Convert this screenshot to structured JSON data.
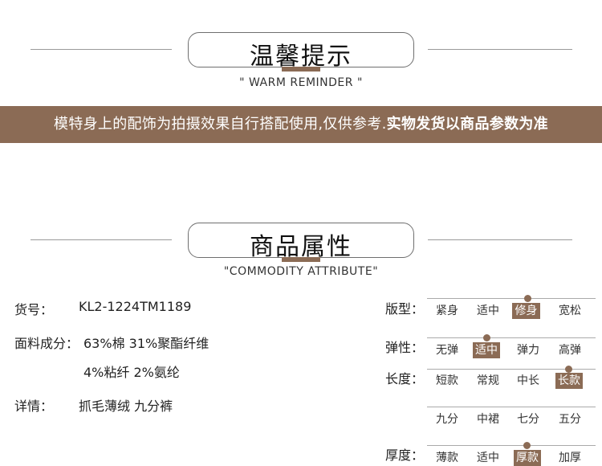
{
  "reminder": {
    "title": "温馨提示",
    "subtitle": "\" WARM REMINDER \"",
    "notice_normal": "模特身上的配饰为拍摄效果自行搭配使用,仅供参考.",
    "notice_bold": "实物发货以商品参数为准"
  },
  "attributes": {
    "title": "商品属性",
    "subtitle": "\"COMMODITY ATTRIBUTE\""
  },
  "info": {
    "sku_label": "货号：",
    "sku_value": "KL2-1224TM1189",
    "fabric_label": "面料成分：",
    "fabric_line1": "63%棉 31%聚酯纤维",
    "fabric_line2": "4%粘纤 2%氨纶",
    "detail_label": "详情：",
    "detail_value": "抓毛薄绒 九分裤"
  },
  "specs": {
    "fit": {
      "label": "版型：",
      "options": [
        "紧身",
        "适中",
        "修身",
        "宽松"
      ],
      "selected": 2
    },
    "stretch": {
      "label": "弹性：",
      "options": [
        "无弹",
        "适中",
        "弹力",
        "高弹"
      ],
      "selected": 1
    },
    "length": {
      "label": "长度：",
      "options": [
        "短款",
        "常规",
        "中长",
        "长款"
      ],
      "selected": 3,
      "options2": [
        "九分",
        "中裙",
        "七分",
        "五分"
      ]
    },
    "thickness": {
      "label": "厚度：",
      "options": [
        "薄款",
        "适中",
        "厚款",
        "加厚"
      ],
      "selected": 2
    }
  },
  "colors": {
    "accent": "#8b6b55"
  }
}
